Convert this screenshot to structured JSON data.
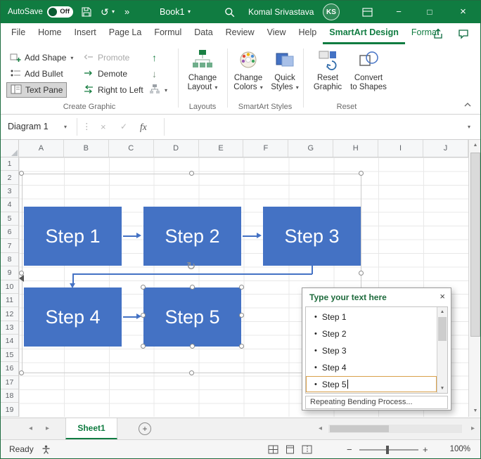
{
  "colors": {
    "excel_green": "#107C41",
    "accent_blue": "#4472C4"
  },
  "title_bar": {
    "autosave_label": "AutoSave",
    "autosave_state": "Off",
    "workbook_name": "Book1",
    "user_name": "Komal Srivastava",
    "user_initials": "KS"
  },
  "tabs": {
    "file": "File",
    "home": "Home",
    "insert": "Insert",
    "page_layout": "Page La",
    "formulas": "Formul",
    "data": "Data",
    "review": "Review",
    "view": "View",
    "help": "Help",
    "smartart_design": "SmartArt Design",
    "format": "Format"
  },
  "ribbon": {
    "add_shape": "Add Shape",
    "add_bullet": "Add Bullet",
    "text_pane": "Text Pane",
    "promote": "Promote",
    "demote": "Demote",
    "right_to_left": "Right to Left",
    "create_graphic_label": "Create Graphic",
    "change_layout_line1": "Change",
    "change_layout_line2": "Layout",
    "layouts_label": "Layouts",
    "change_colors_line1": "Change",
    "change_colors_line2": "Colors",
    "quick_styles_line1": "Quick",
    "quick_styles_line2": "Styles",
    "smartart_styles_label": "SmartArt Styles",
    "reset_graphic_line1": "Reset",
    "reset_graphic_line2": "Graphic",
    "convert_line1": "Convert",
    "convert_line2": "to Shapes",
    "reset_label": "Reset"
  },
  "formula_bar": {
    "name_box_value": "Diagram 1",
    "fx_label": "fx",
    "formula_value": ""
  },
  "sheet": {
    "cols": [
      "A",
      "B",
      "C",
      "D",
      "E",
      "F",
      "G",
      "H",
      "I",
      "J"
    ],
    "rows": [
      "1",
      "2",
      "3",
      "4",
      "5",
      "6",
      "7",
      "8",
      "9",
      "10",
      "11",
      "12",
      "13",
      "14",
      "15",
      "16",
      "17",
      "18",
      "19"
    ]
  },
  "smartart": {
    "steps": [
      "Step 1",
      "Step 2",
      "Step 3",
      "Step 4",
      "Step 5"
    ]
  },
  "text_pane": {
    "title": "Type your text here",
    "items": [
      "Step 1",
      "Step 2",
      "Step 3",
      "Step 4",
      "Step 5"
    ],
    "footer": "Repeating Bending Process..."
  },
  "sheet_tabs": {
    "sheet1": "Sheet1"
  },
  "status_bar": {
    "ready_label": "Ready",
    "zoom_level": "100%"
  },
  "glyphs": {
    "caret_down": "▾",
    "close": "×",
    "check": "✓",
    "undo": "↺",
    "more": "»",
    "minimize": "−",
    "maximize": "□",
    "scroll_up": "▲",
    "scroll_down": "▼",
    "nav_left": "◂",
    "nav_right": "▸",
    "plus": "+",
    "minus": "−",
    "move_up": "↑",
    "move_down": "↓",
    "rotate": "↻",
    "bullet": "•",
    "grip": "⋮",
    "add_sheet": "+"
  }
}
